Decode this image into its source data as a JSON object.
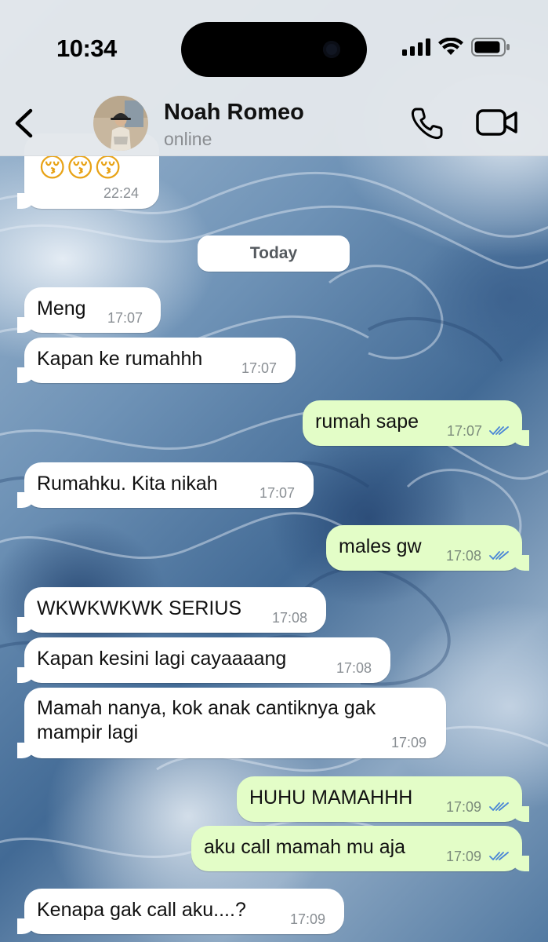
{
  "status_bar": {
    "time": "10:34",
    "signal_icon": "cellular-signal-icon",
    "wifi_icon": "wifi-icon",
    "battery_icon": "battery-icon"
  },
  "header": {
    "contact_name": "Noah Romeo",
    "contact_status": "online",
    "back_icon": "chevron-left-icon",
    "call_icon": "phone-icon",
    "video_icon": "video-camera-icon"
  },
  "colors": {
    "incoming_bubble": "#ffffff",
    "outgoing_bubble": "#e3fdc7",
    "read_ticks": "#4a86d6",
    "header_bg": "#e3e7eb"
  },
  "chat": {
    "date_separator": "Today",
    "previous_message": {
      "emojis": "😚😚😚",
      "time": "22:24"
    },
    "messages": [
      {
        "direction": "incoming",
        "text": "Meng",
        "time": "17:07"
      },
      {
        "direction": "incoming",
        "text": "Kapan ke rumahhh",
        "time": "17:07"
      },
      {
        "direction": "outgoing",
        "text": "rumah sape",
        "time": "17:07",
        "status": "read"
      },
      {
        "direction": "incoming",
        "text": "Rumahku. Kita nikah",
        "time": "17:07"
      },
      {
        "direction": "outgoing",
        "text": "males gw",
        "time": "17:08",
        "status": "read"
      },
      {
        "direction": "incoming",
        "text": "WKWKWKWK SERIUS",
        "time": "17:08"
      },
      {
        "direction": "incoming",
        "text": "Kapan kesini lagi cayaaaang",
        "time": "17:08"
      },
      {
        "direction": "incoming",
        "text": "Mamah nanya, kok anak cantiknya gak mampir lagi",
        "time": "17:09"
      },
      {
        "direction": "outgoing",
        "text": "HUHU MAMAHHH",
        "time": "17:09",
        "status": "read"
      },
      {
        "direction": "outgoing",
        "text": "aku call mamah mu aja",
        "time": "17:09",
        "status": "read"
      },
      {
        "direction": "incoming",
        "text": "Kenapa gak call aku....?",
        "time": "17:09"
      }
    ]
  }
}
